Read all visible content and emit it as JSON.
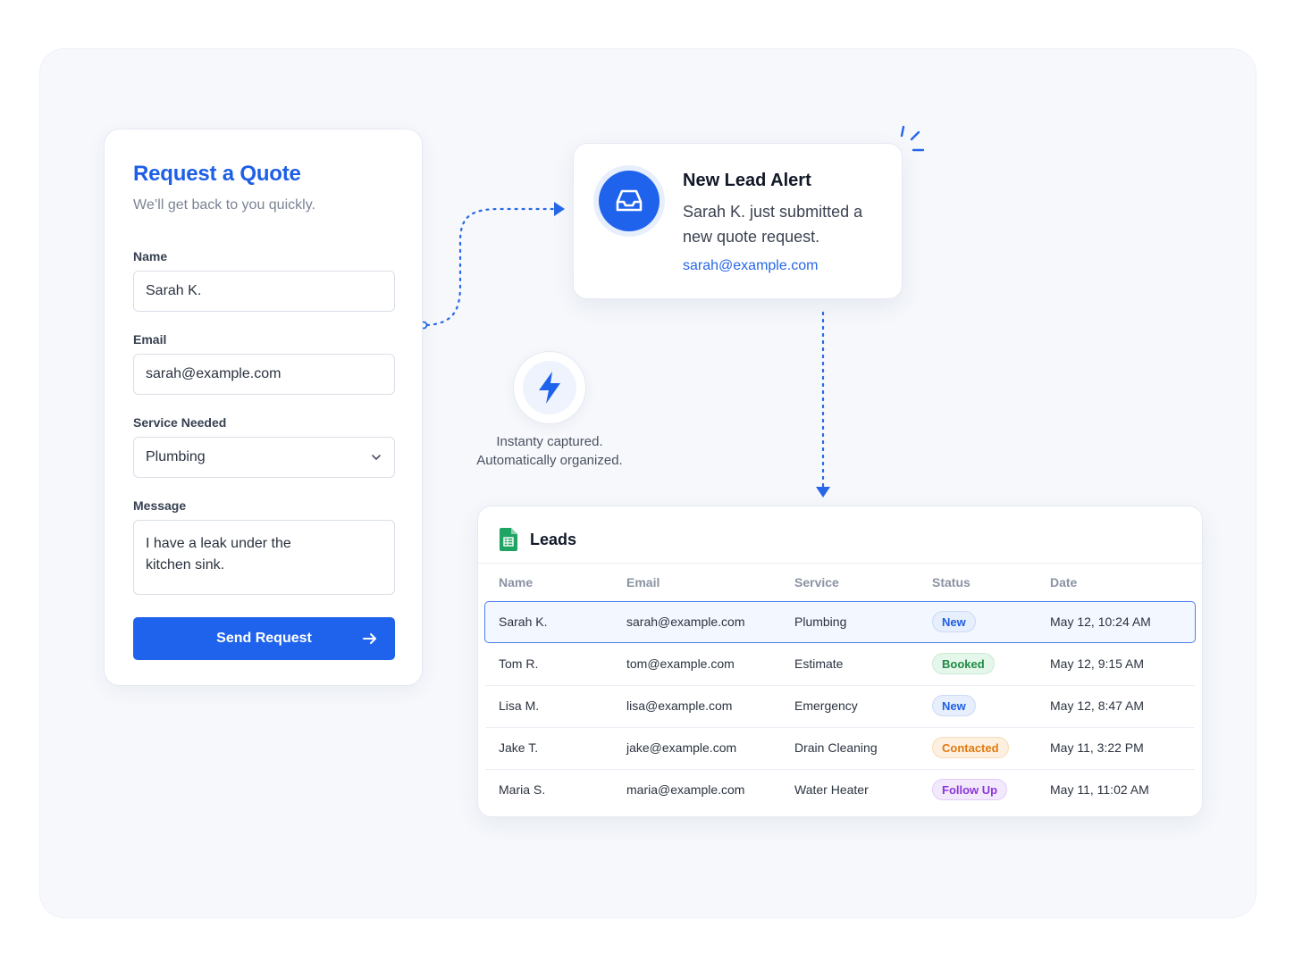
{
  "form": {
    "title": "Request a Quote",
    "subtitle": "We’ll get back to you quickly.",
    "name_label": "Name",
    "name_value": "Sarah K.",
    "email_label": "Email",
    "email_value": "sarah@example.com",
    "service_label": "Service Needed",
    "service_value": "Plumbing",
    "message_label": "Message",
    "message_value": "I have a leak under the\nkitchen sink.",
    "submit_label": "Send Request"
  },
  "alert": {
    "title": "New Lead Alert",
    "body": "Sarah K. just submitted a new quote request.",
    "email": "sarah@example.com",
    "icon": "inbox-icon"
  },
  "captured": {
    "text": "Instanty captured. Automatically organized.",
    "icon": "lightning-bolt-icon"
  },
  "leads": {
    "title": "Leads",
    "icon": "spreadsheet-icon",
    "columns": [
      "Name",
      "Email",
      "Service",
      "Status",
      "Date"
    ],
    "rows": [
      {
        "name": "Sarah K.",
        "email": "sarah@example.com",
        "service": "Plumbing",
        "status": "New",
        "date": "May 12, 10:24 AM"
      },
      {
        "name": "Tom R.",
        "email": "tom@example.com",
        "service": "Estimate",
        "status": "Booked",
        "date": "May 12, 9:15 AM"
      },
      {
        "name": "Lisa M.",
        "email": "lisa@example.com",
        "service": "Emergency",
        "status": "New",
        "date": "May 12, 8:47 AM"
      },
      {
        "name": "Jake T.",
        "email": "jake@example.com",
        "service": "Drain Cleaning",
        "status": "Contacted",
        "date": "May 11, 3:22 PM"
      },
      {
        "name": "Maria S.",
        "email": "maria@example.com",
        "service": "Water Heater",
        "status": "Follow Up",
        "date": "May 11, 11:02 AM"
      }
    ]
  },
  "colors": {
    "accent": "#1f63ec",
    "status_new": "#1f5fe0",
    "status_booked": "#1f8a45",
    "status_contacted": "#e07a10",
    "status_follow_up": "#8a35d8"
  }
}
